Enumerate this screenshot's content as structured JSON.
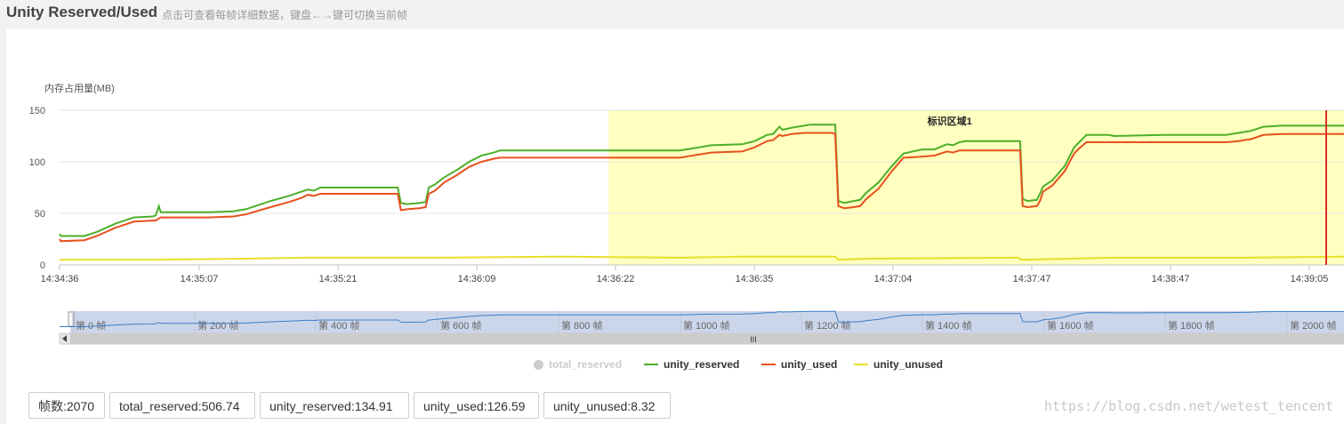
{
  "header": {
    "title": "Unity Reserved/Used",
    "subtitle": "点击可查看每帧详细数据，键盘←→键可切换当前帧"
  },
  "chart_data": {
    "type": "line",
    "ylabel": "内存占用量(MB)",
    "ylim": [
      0,
      150
    ],
    "yticks": [
      0,
      50,
      100,
      150
    ],
    "grid": true,
    "x_ticks": [
      "14:34:36",
      "14:35:07",
      "14:35:21",
      "14:36:09",
      "14:36:22",
      "14:36:35",
      "14:37:04",
      "14:37:47",
      "14:38:47",
      "14:39:05"
    ],
    "frame_range": [
      0,
      2070
    ],
    "marked_region": {
      "label": "标识区域1",
      "start_frame": 885,
      "end_frame": 2070,
      "color": "#ffffc0"
    },
    "current_frame": 2070,
    "series": [
      {
        "name": "total_reserved",
        "color": "#cccccc",
        "visible": false
      },
      {
        "name": "unity_reserved",
        "color": "#4caf2a",
        "points": [
          [
            0,
            30
          ],
          [
            2,
            28
          ],
          [
            40,
            28
          ],
          [
            60,
            32
          ],
          [
            90,
            40
          ],
          [
            120,
            46
          ],
          [
            150,
            47
          ],
          [
            155,
            48
          ],
          [
            160,
            57
          ],
          [
            163,
            51
          ],
          [
            240,
            51
          ],
          [
            280,
            52
          ],
          [
            300,
            54
          ],
          [
            340,
            62
          ],
          [
            370,
            67
          ],
          [
            390,
            71
          ],
          [
            400,
            73
          ],
          [
            410,
            72
          ],
          [
            420,
            75
          ],
          [
            540,
            75
          ],
          [
            545,
            75
          ],
          [
            550,
            60
          ],
          [
            560,
            59
          ],
          [
            580,
            60
          ],
          [
            590,
            61
          ],
          [
            595,
            75
          ],
          [
            605,
            78
          ],
          [
            620,
            85
          ],
          [
            640,
            92
          ],
          [
            660,
            100
          ],
          [
            680,
            106
          ],
          [
            700,
            109
          ],
          [
            710,
            111
          ],
          [
            1000,
            111
          ],
          [
            1010,
            112
          ],
          [
            1030,
            114
          ],
          [
            1050,
            116
          ],
          [
            1100,
            117
          ],
          [
            1120,
            120
          ],
          [
            1140,
            126
          ],
          [
            1150,
            127
          ],
          [
            1160,
            134
          ],
          [
            1165,
            131
          ],
          [
            1180,
            133
          ],
          [
            1200,
            135
          ],
          [
            1210,
            136
          ],
          [
            1245,
            136
          ],
          [
            1250,
            136
          ],
          [
            1255,
            62
          ],
          [
            1265,
            60
          ],
          [
            1280,
            62
          ],
          [
            1290,
            63
          ],
          [
            1300,
            70
          ],
          [
            1320,
            80
          ],
          [
            1340,
            95
          ],
          [
            1360,
            108
          ],
          [
            1390,
            112
          ],
          [
            1410,
            112
          ],
          [
            1430,
            117
          ],
          [
            1440,
            116
          ],
          [
            1450,
            119
          ],
          [
            1460,
            120
          ],
          [
            1545,
            120
          ],
          [
            1548,
            120
          ],
          [
            1552,
            64
          ],
          [
            1560,
            62
          ],
          [
            1575,
            63
          ],
          [
            1580,
            69
          ],
          [
            1585,
            76
          ],
          [
            1600,
            82
          ],
          [
            1620,
            96
          ],
          [
            1635,
            114
          ],
          [
            1645,
            120
          ],
          [
            1655,
            126
          ],
          [
            1690,
            126
          ],
          [
            1700,
            125
          ],
          [
            1780,
            126
          ],
          [
            1880,
            126
          ],
          [
            1900,
            128
          ],
          [
            1920,
            130
          ],
          [
            1940,
            134
          ],
          [
            1970,
            135
          ],
          [
            2070,
            135
          ]
        ]
      },
      {
        "name": "unity_used",
        "color": "#e8501e",
        "points": [
          [
            0,
            25
          ],
          [
            2,
            23
          ],
          [
            40,
            24
          ],
          [
            60,
            28
          ],
          [
            90,
            36
          ],
          [
            120,
            42
          ],
          [
            150,
            43
          ],
          [
            155,
            43
          ],
          [
            160,
            45
          ],
          [
            163,
            46
          ],
          [
            240,
            46
          ],
          [
            280,
            47
          ],
          [
            300,
            49
          ],
          [
            340,
            56
          ],
          [
            370,
            61
          ],
          [
            390,
            65
          ],
          [
            400,
            68
          ],
          [
            410,
            67
          ],
          [
            420,
            69
          ],
          [
            540,
            69
          ],
          [
            545,
            69
          ],
          [
            550,
            53
          ],
          [
            560,
            54
          ],
          [
            580,
            55
          ],
          [
            590,
            56
          ],
          [
            595,
            69
          ],
          [
            605,
            72
          ],
          [
            620,
            80
          ],
          [
            640,
            87
          ],
          [
            660,
            95
          ],
          [
            680,
            100
          ],
          [
            700,
            103
          ],
          [
            710,
            104
          ],
          [
            1000,
            104
          ],
          [
            1010,
            105
          ],
          [
            1030,
            107
          ],
          [
            1050,
            109
          ],
          [
            1100,
            110
          ],
          [
            1120,
            114
          ],
          [
            1140,
            120
          ],
          [
            1150,
            121
          ],
          [
            1160,
            126
          ],
          [
            1165,
            125
          ],
          [
            1180,
            127
          ],
          [
            1200,
            128
          ],
          [
            1210,
            128
          ],
          [
            1245,
            128
          ],
          [
            1250,
            127
          ],
          [
            1255,
            57
          ],
          [
            1265,
            55
          ],
          [
            1280,
            56
          ],
          [
            1290,
            57
          ],
          [
            1300,
            64
          ],
          [
            1320,
            74
          ],
          [
            1340,
            90
          ],
          [
            1360,
            104
          ],
          [
            1390,
            105
          ],
          [
            1410,
            106
          ],
          [
            1430,
            110
          ],
          [
            1440,
            109
          ],
          [
            1450,
            111
          ],
          [
            1460,
            111
          ],
          [
            1545,
            111
          ],
          [
            1548,
            111
          ],
          [
            1552,
            57
          ],
          [
            1560,
            56
          ],
          [
            1575,
            57
          ],
          [
            1580,
            62
          ],
          [
            1585,
            71
          ],
          [
            1600,
            77
          ],
          [
            1620,
            91
          ],
          [
            1635,
            108
          ],
          [
            1645,
            114
          ],
          [
            1655,
            119
          ],
          [
            1690,
            119
          ],
          [
            1700,
            119
          ],
          [
            1780,
            119
          ],
          [
            1880,
            119
          ],
          [
            1900,
            120
          ],
          [
            1920,
            122
          ],
          [
            1940,
            126
          ],
          [
            1970,
            127
          ],
          [
            2070,
            127
          ]
        ]
      },
      {
        "name": "unity_unused",
        "color": "#e6e02a",
        "points": [
          [
            0,
            5
          ],
          [
            150,
            5
          ],
          [
            300,
            6
          ],
          [
            400,
            7
          ],
          [
            600,
            7
          ],
          [
            800,
            8
          ],
          [
            1000,
            7
          ],
          [
            1100,
            8
          ],
          [
            1250,
            8
          ],
          [
            1255,
            5
          ],
          [
            1300,
            6
          ],
          [
            1545,
            7
          ],
          [
            1550,
            5
          ],
          [
            1700,
            7
          ],
          [
            1900,
            7
          ],
          [
            2070,
            8
          ]
        ]
      }
    ]
  },
  "navigator": {
    "labels": [
      "第 0 帧",
      "第 200 帧",
      "第 400 帧",
      "第 600 帧",
      "第 800 帧",
      "第 1000 帧",
      "第 1200 帧",
      "第 1400 帧",
      "第 1600 帧",
      "第 1800 帧",
      "第 2000 帧"
    ],
    "scroll_grip": "III"
  },
  "stats": [
    {
      "label": "帧数:2070"
    },
    {
      "label": "total_reserved:506.74"
    },
    {
      "label": "unity_reserved:134.91"
    },
    {
      "label": "unity_used:126.59"
    },
    {
      "label": "unity_unused:8.32"
    }
  ],
  "watermark": "https://blog.csdn.net/wetest_tencent"
}
